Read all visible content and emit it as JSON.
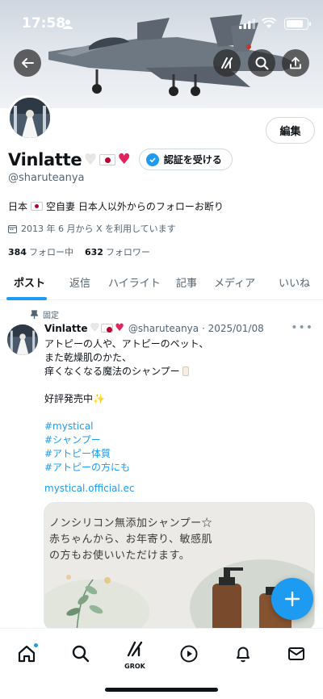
{
  "status": {
    "time": "17:58"
  },
  "profile": {
    "name": "Vinlatte",
    "handle": "@sharuteanya",
    "edit_label": "編集",
    "verify_label": "認証を受ける",
    "bio_part1": "日本",
    "bio_part2": "空自妻 日本人以外からのフォローお断り",
    "joined": "2013 年 6 月から X を利用しています",
    "following_count": "384",
    "following_label": "フォロー中",
    "followers_count": "632",
    "followers_label": "フォロワー"
  },
  "tabs": [
    {
      "label": "ポスト"
    },
    {
      "label": "返信"
    },
    {
      "label": "ハイライト"
    },
    {
      "label": "記事"
    },
    {
      "label": "メディア"
    },
    {
      "label": "いいね"
    }
  ],
  "post": {
    "pinned_label": "固定",
    "author": "Vinlatte",
    "meta": "@sharuteanya · 2025/01/08",
    "lines": [
      "アトピーの人や、アトピーのペット、",
      "また乾燥肌のかた、",
      "痒くなくなる魔法のシャンプー",
      "",
      "好評発売中",
      ""
    ],
    "hashtags": [
      "#mystical",
      "#シャンプー",
      "#アトピー体質",
      "#アトピーの方にも"
    ],
    "link": "mystical.official.ec",
    "image_text": [
      "ノンシリコン無添加シャンプー☆",
      "赤ちゃんから、お年寄り、敏感肌",
      "の方もお使いいただけます。"
    ]
  },
  "nav": {
    "grok_label": "GROK"
  },
  "colors": {
    "accent": "#1d9bf0",
    "text": "#0f1419",
    "muted": "#536471"
  }
}
